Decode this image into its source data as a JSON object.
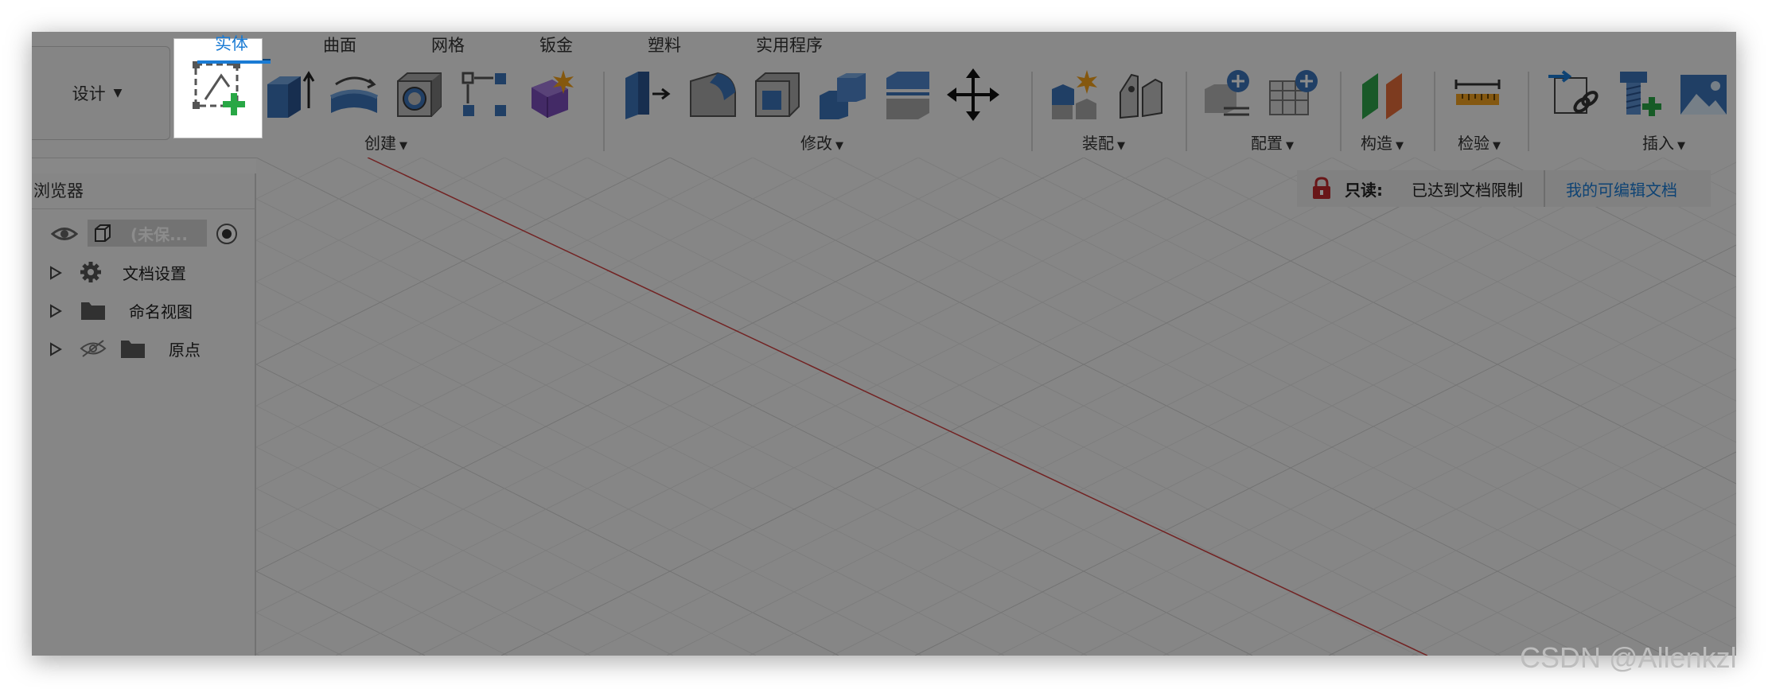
{
  "design_menu": {
    "label": "设计",
    "caret": "▼"
  },
  "tabs": [
    {
      "label": "实体",
      "active": true
    },
    {
      "label": "曲面",
      "active": false
    },
    {
      "label": "网格",
      "active": false
    },
    {
      "label": "钣金",
      "active": false
    },
    {
      "label": "塑料",
      "active": false
    },
    {
      "label": "实用程序",
      "active": false
    }
  ],
  "groups": {
    "create": "创建",
    "modify": "修改",
    "assemble": "装配",
    "configure": "配置",
    "construct": "构造",
    "inspect": "检验",
    "insert": "插入"
  },
  "caret": "▼",
  "browser": {
    "title": "浏览器",
    "root_label": "(未保...",
    "items": [
      {
        "label": "文档设置"
      },
      {
        "label": "命名视图"
      },
      {
        "label": "原点"
      }
    ]
  },
  "readonly": {
    "label": "只读:",
    "message": "已达到文档限制",
    "link": "我的可编辑文档"
  },
  "watermark": "CSDN @Allenkzl",
  "colors": {
    "accent": "#1a7bd4",
    "tool_blue": "#3b73b9",
    "axis_red": "#d04040"
  }
}
